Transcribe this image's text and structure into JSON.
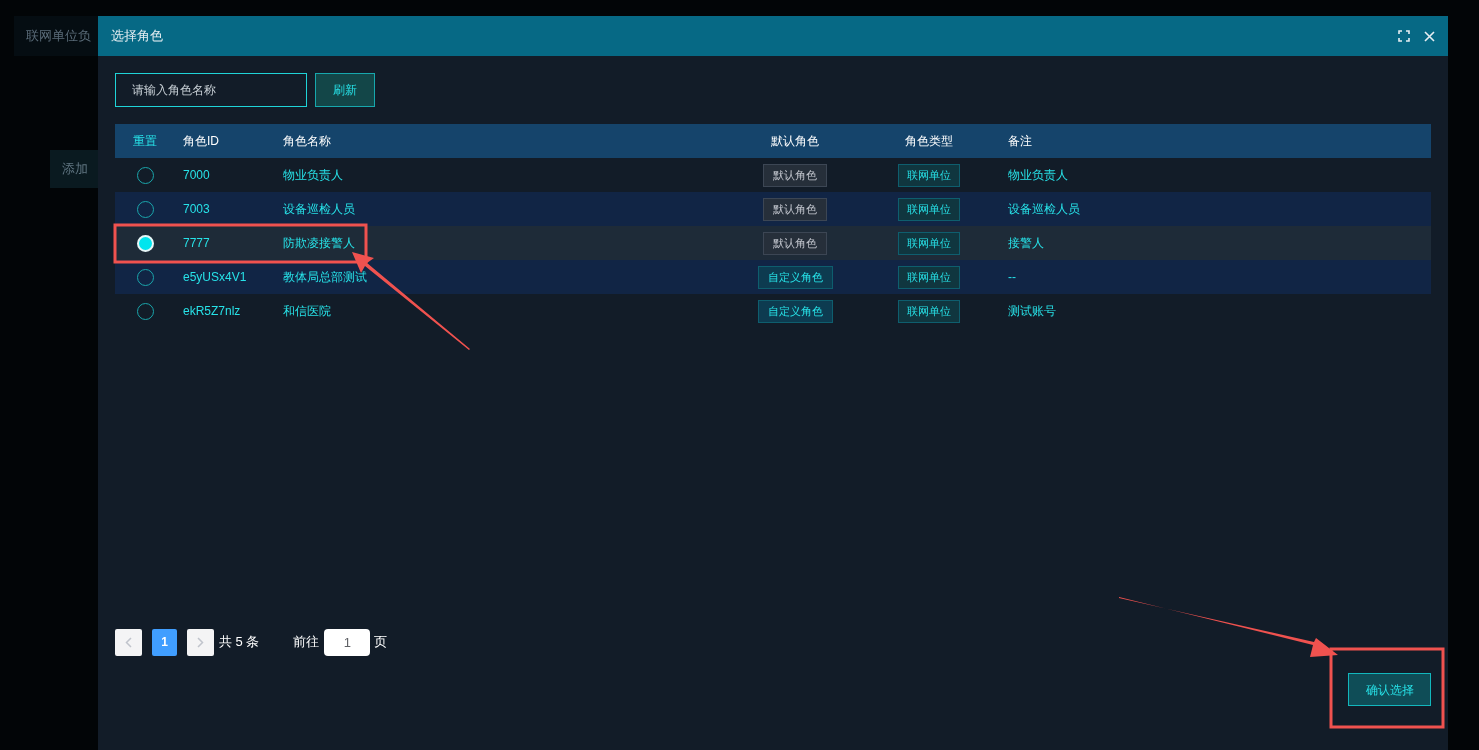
{
  "background_page": {
    "title": "联网单位负",
    "tab": "添加"
  },
  "dialog": {
    "title": "选择角色",
    "search": {
      "placeholder": "请输入角色名称"
    },
    "refresh_button": "刷新",
    "table": {
      "columns": [
        "重置",
        "角色ID",
        "角色名称",
        "默认角色",
        "角色类型",
        "备注"
      ],
      "rows": [
        {
          "selected": false,
          "id": "7000",
          "name": "物业负责人",
          "default_role": {
            "kind": "default",
            "text": "默认角色"
          },
          "type": "联网单位",
          "remark": "物业负责人"
        },
        {
          "selected": false,
          "id": "7003",
          "name": "设备巡检人员",
          "default_role": {
            "kind": "default",
            "text": "默认角色"
          },
          "type": "联网单位",
          "remark": "设备巡检人员"
        },
        {
          "selected": true,
          "id": "7777",
          "name": "防欺凌接警人",
          "default_role": {
            "kind": "default",
            "text": "默认角色"
          },
          "type": "联网单位",
          "remark": "接警人"
        },
        {
          "selected": false,
          "id": "e5yUSx4V1",
          "name": "教体局总部测试",
          "default_role": {
            "kind": "custom",
            "text": "自定义角色"
          },
          "type": "联网单位",
          "remark": "--"
        },
        {
          "selected": false,
          "id": "ekR5Z7nlz",
          "name": "和信医院",
          "default_role": {
            "kind": "custom",
            "text": "自定义角色"
          },
          "type": "联网单位",
          "remark": "测试账号"
        }
      ]
    },
    "pagination": {
      "pages": [
        {
          "label": "1",
          "selected": true
        }
      ],
      "total": "共 5 条",
      "goto_label": "前往",
      "goto_value": "1",
      "page_unit": "页"
    },
    "confirm_button": "确认选择"
  }
}
